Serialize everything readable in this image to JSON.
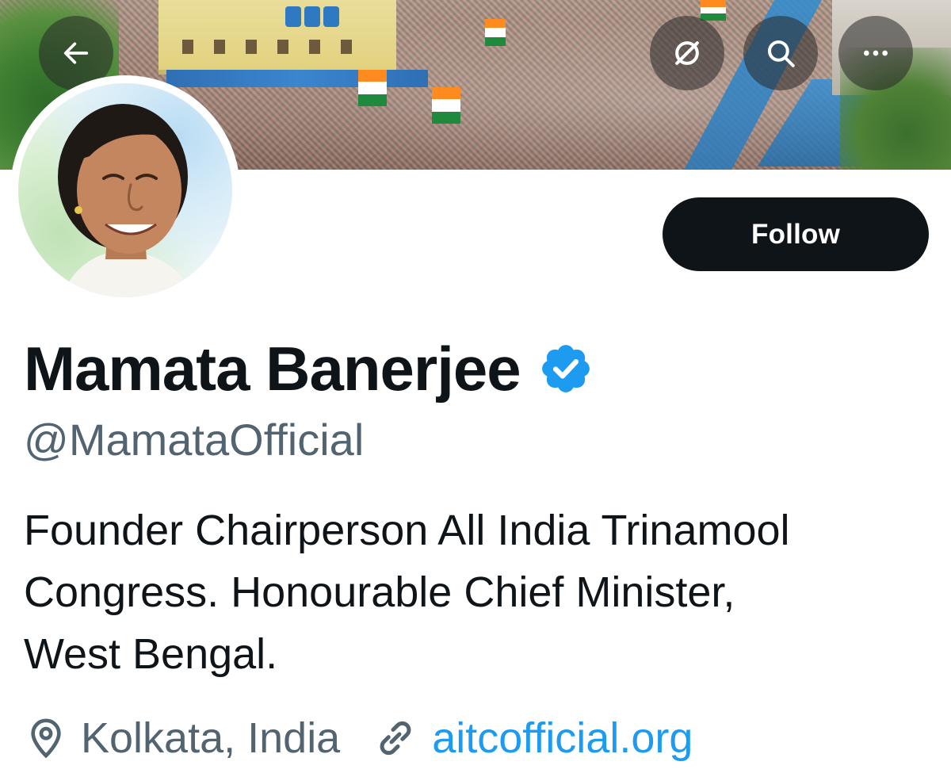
{
  "header": {
    "back_icon": "arrow-left-icon",
    "grok_icon": "slashed-circle-icon",
    "search_icon": "search-icon",
    "more_icon": "more-horizontal-icon"
  },
  "profile": {
    "name": "Mamata Banerjee",
    "verified_icon": "verified-badge-icon",
    "handle": "@MamataOfficial",
    "bio_lines": [
      "Founder Chairperson All India Trinamool",
      "Congress. Honourable Chief Minister,",
      "West Bengal."
    ],
    "location": "Kolkata, India",
    "website": "aitcofficial.org",
    "follow_label": "Follow"
  },
  "colors": {
    "primary_text": "#0f1419",
    "secondary_text": "#536471",
    "link": "#1d9bf0",
    "verified": "#1d9bf0",
    "follow_bg": "#0f1419"
  }
}
